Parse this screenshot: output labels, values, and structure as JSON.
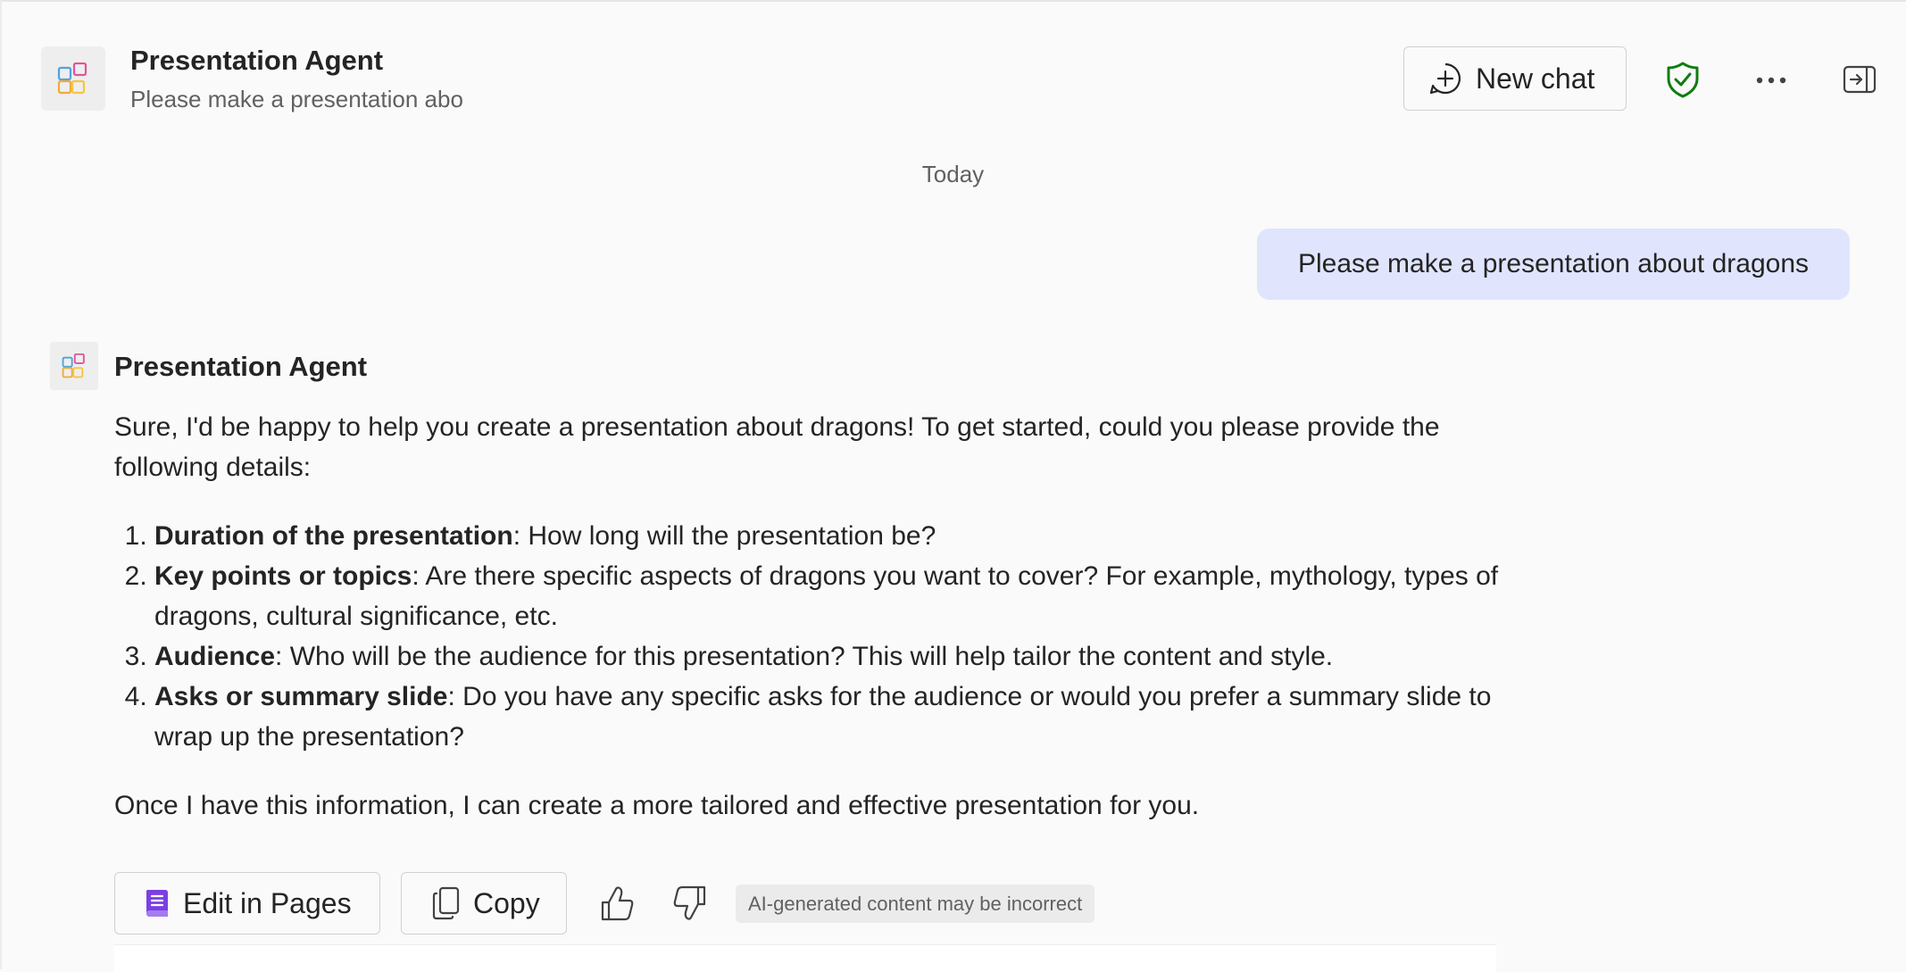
{
  "header": {
    "title": "Presentation Agent",
    "subtitle": "Please make a presentation abo",
    "new_chat_label": "New chat",
    "icons": [
      "agent-logo-icon",
      "plus-circle-icon",
      "shield-check-icon",
      "more-icon",
      "panel-open-icon"
    ]
  },
  "conversation": {
    "date_label": "Today",
    "user_message": "Please make a presentation about dragons",
    "agent_name": "Presentation Agent",
    "intro": "Sure, I'd be happy to help you create a presentation about dragons! To get started, could you please provide the following details:",
    "items": [
      {
        "title": "Duration of the presentation",
        "text": ": How long will the presentation be?"
      },
      {
        "title": "Key points or topics",
        "text": ": Are there specific aspects of dragons you want to cover? For example, mythology, types of dragons, cultural significance, etc."
      },
      {
        "title": "Audience",
        "text": ": Who will be the audience for this presentation? This will help tailor the content and style."
      },
      {
        "title": "Asks or summary slide",
        "text": ": Do you have any specific asks for the audience or would you prefer a summary slide to wrap up the presentation?"
      }
    ],
    "outro": "Once I have this information, I can create a more tailored and effective presentation for you."
  },
  "actions": {
    "edit_label": "Edit in Pages",
    "copy_label": "Copy",
    "disclaimer": "AI-generated content may be incorrect"
  },
  "colors": {
    "background": "#fafafa",
    "user_bubble": "#e0e5fd",
    "shield_green": "#107c10",
    "pages_purple": "#7b3fe4"
  }
}
